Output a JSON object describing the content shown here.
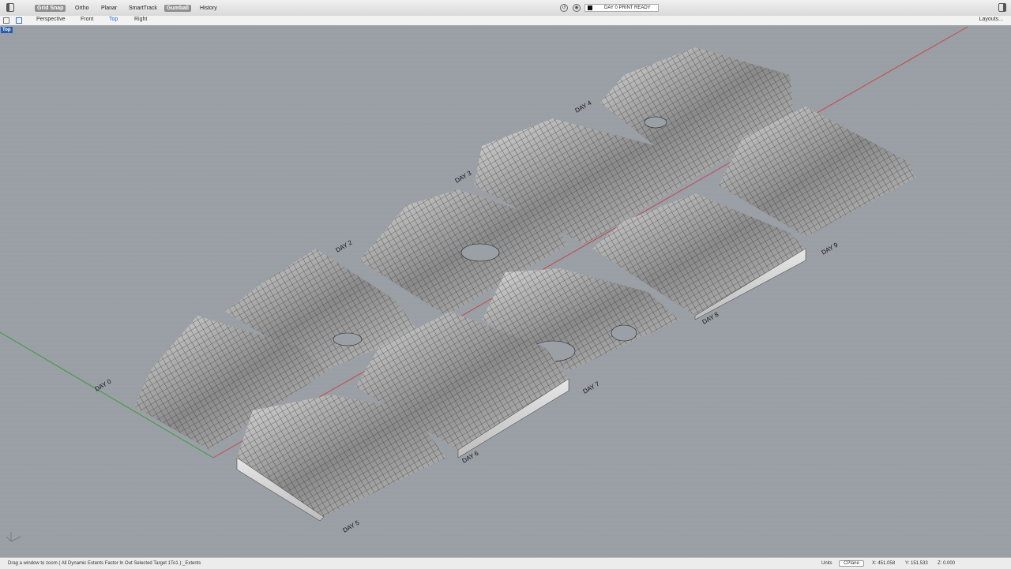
{
  "toolbar": {
    "toggles": [
      "Grid Snap",
      "Ortho",
      "Planar",
      "SmartTrack",
      "Gumball",
      "History"
    ],
    "status_text": "DAY 0 PRINT READY",
    "icons": [
      "sidebar-left-icon",
      "back-icon",
      "record-icon",
      "sidebar-right-icon"
    ]
  },
  "viewbar": {
    "tabs": [
      "Perspective",
      "Front",
      "Top",
      "Right"
    ],
    "active_tab": "Top",
    "layouts": "Layouts..."
  },
  "viewport": {
    "label": "Top",
    "day_labels": [
      "DAY 0",
      "DAY 2",
      "DAY 3",
      "DAY 4",
      "DAY 5",
      "DAY 6",
      "DAY 7",
      "DAY 8",
      "DAY 9"
    ],
    "axis_colors": {
      "x": "#c84646",
      "y": "#3e9a3e"
    },
    "background": "#9aa0a6"
  },
  "statusbar": {
    "command": "Drag a window to zoom ( All Dynamic Extents Factor In Out Selected Target 1To1 ):_Extents",
    "units_label": "Units",
    "cplane": "CPlane",
    "x": "X: 451.058",
    "y": "Y: 151.533",
    "z": "Z: 0.000"
  }
}
